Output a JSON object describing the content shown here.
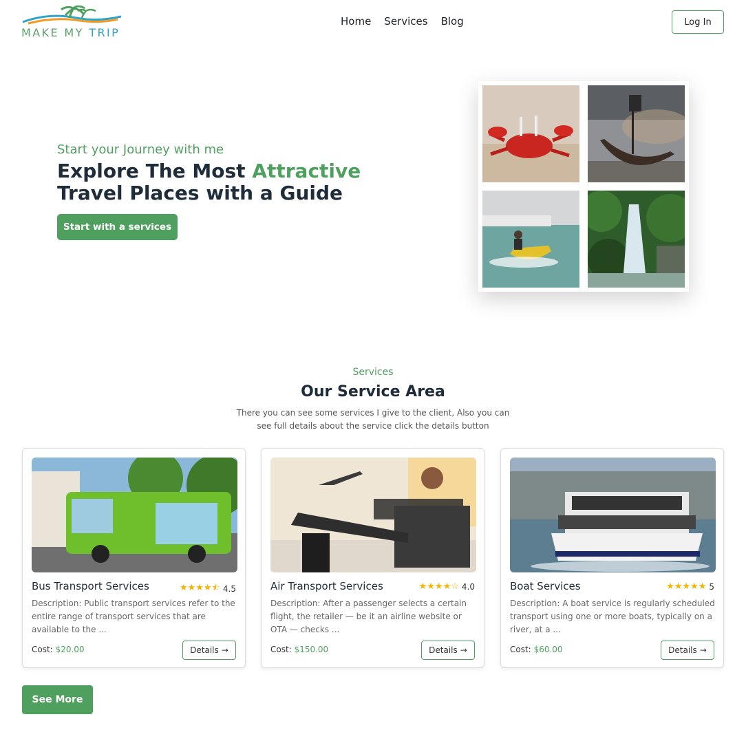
{
  "brand": {
    "logo_text_a": "MAKE MY",
    "logo_text_b": "TRIP"
  },
  "nav": {
    "items": [
      "Home",
      "Services",
      "Blog"
    ],
    "login_label": "Log In"
  },
  "hero": {
    "subtitle": "Start your Journey with me",
    "title_part1": "Explore The Most",
    "title_accent": "Attractive",
    "title_part2": "Travel Places with a Guide",
    "button_label": "Start with a services"
  },
  "services": {
    "label": "Services",
    "title": "Our Service Area",
    "description": "There you can see some services I give to the client, Also you can see full details about the service click the details button",
    "cards": [
      {
        "title": "Bus Transport Services",
        "rating": "4.5",
        "stars": "★★★★⯪",
        "description": "Description: Public transport services refer to the entire range of transport services that are available to the ...",
        "cost_label": "Cost:",
        "cost": "$20.00",
        "details_label": "Details",
        "image": "green-bus-photo"
      },
      {
        "title": "Air Transport Services",
        "rating": "4.0",
        "stars": "★★★★☆",
        "description": "Description: After a passenger selects a certain flight, the retailer — be it an airline website or OTA — checks ...",
        "cost_label": "Cost:",
        "cost": "$150.00",
        "details_label": "Details",
        "image": "airport-lounge-photo"
      },
      {
        "title": "Boat Services",
        "rating": "5",
        "stars": "★★★★★",
        "description": "Description: A boat service is regularly scheduled transport using one or more boats, typically on a river, at a ...",
        "cost_label": "Cost:",
        "cost": "$60.00",
        "details_label": "Details",
        "image": "ferry-boat-photo"
      }
    ],
    "see_more_label": "See More"
  },
  "colors": {
    "accent": "#4fa05f",
    "heading": "#1f2d3a",
    "star": "#f5b400"
  },
  "icons": [
    "arrow-right-icon",
    "star-icon",
    "logo-palm-icon"
  ]
}
